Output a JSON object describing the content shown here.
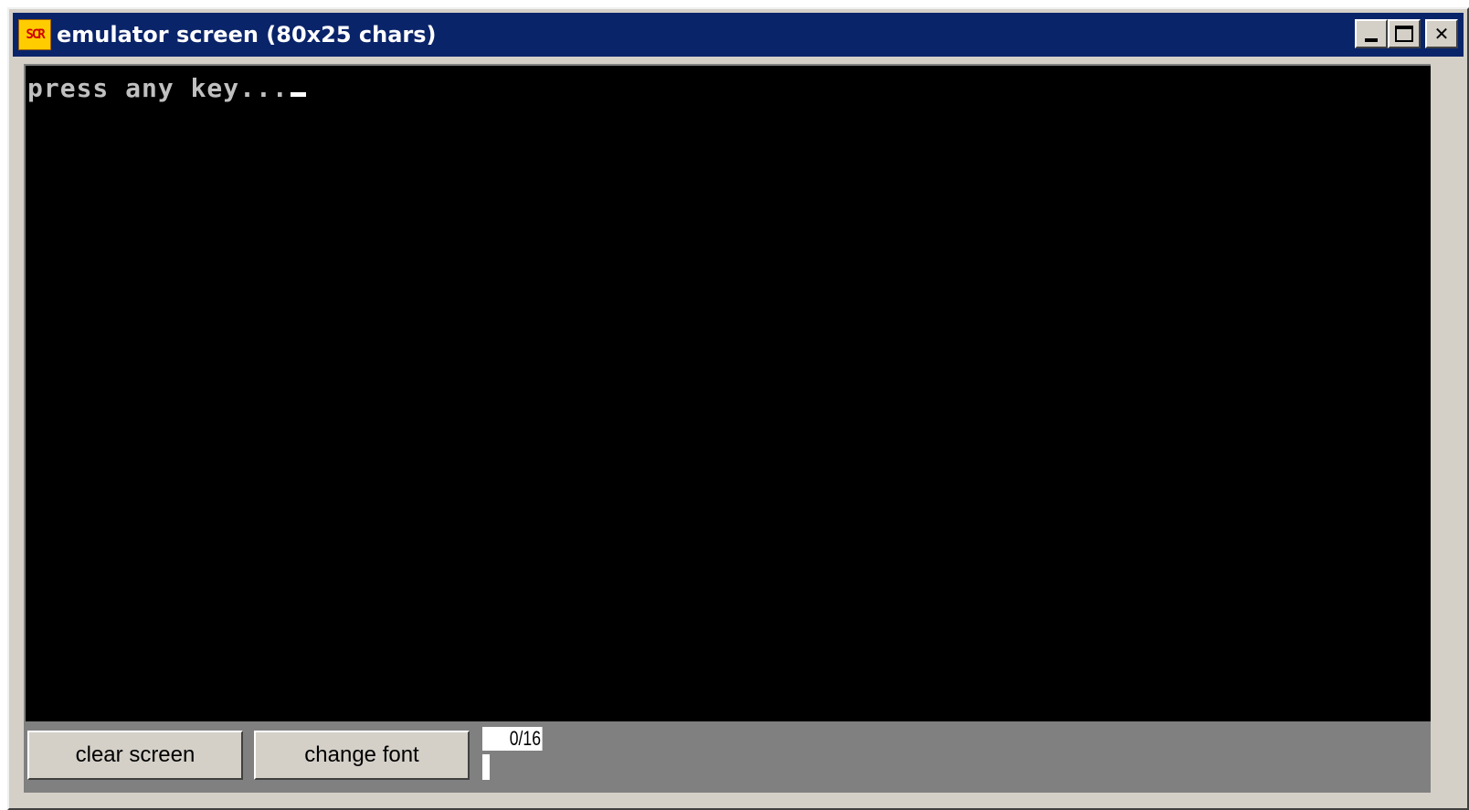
{
  "window": {
    "icon_label": "SCR",
    "title": "emulator screen (80x25 chars)"
  },
  "console": {
    "line1": "press any key..."
  },
  "controls": {
    "clear_label": "clear screen",
    "font_label": "change font",
    "counter": "0/16"
  },
  "icons": {
    "app": "scr-app-icon",
    "minimize": "minimize-icon",
    "maximize": "maximize-icon",
    "close": "close-icon"
  }
}
